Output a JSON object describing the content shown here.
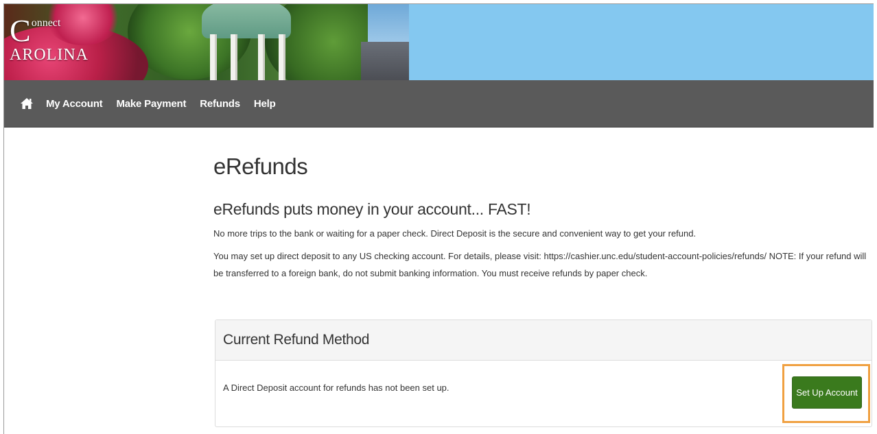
{
  "header": {
    "logo_connect": "onnect",
    "logo_c": "C",
    "logo_carolina": "AROLINA"
  },
  "nav": {
    "home_icon": "home-icon",
    "items": [
      {
        "label": "My Account"
      },
      {
        "label": "Make Payment"
      },
      {
        "label": "Refunds"
      },
      {
        "label": "Help"
      }
    ]
  },
  "main": {
    "title": "eRefunds",
    "subtitle": "eRefunds puts money in your account... FAST!",
    "intro": "No more trips to the bank or waiting for a paper check. Direct Deposit is the secure and convenient way to get your refund.",
    "details": "You may set up direct deposit to any US checking account. For details, please visit: https://cashier.unc.edu/student-account-policies/refunds/ NOTE: If your refund will be transferred to a foreign bank, do not submit banking information. You must receive refunds by paper check."
  },
  "panel": {
    "title": "Current Refund Method",
    "message": "A Direct Deposit account for refunds has not been set up.",
    "button_label": "Set Up Account"
  },
  "colors": {
    "nav_bg": "#5a5a5a",
    "banner_sky": "#84c8f0",
    "button_green": "#3a7a1d",
    "highlight_orange": "#f0a040"
  }
}
